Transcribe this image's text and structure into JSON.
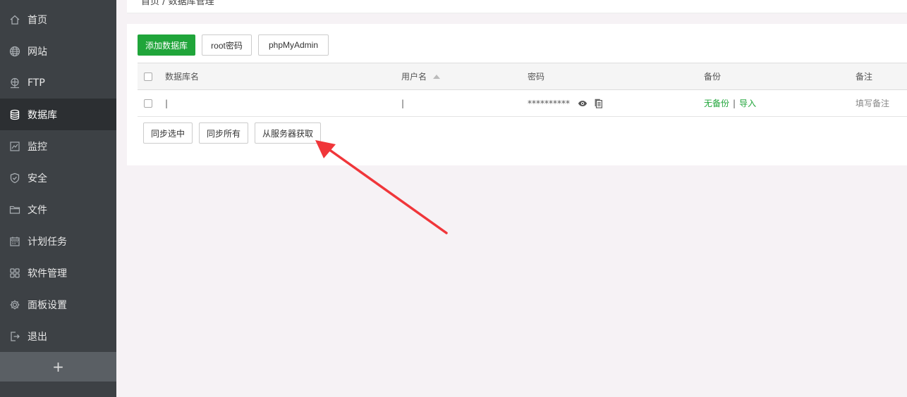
{
  "sidebar": {
    "items": [
      {
        "label": "首页",
        "icon": "home-icon"
      },
      {
        "label": "网站",
        "icon": "globe-icon"
      },
      {
        "label": "FTP",
        "icon": "ftp-icon"
      },
      {
        "label": "数据库",
        "icon": "database-icon"
      },
      {
        "label": "监控",
        "icon": "monitor-icon"
      },
      {
        "label": "安全",
        "icon": "shield-icon"
      },
      {
        "label": "文件",
        "icon": "folder-icon"
      },
      {
        "label": "计划任务",
        "icon": "calendar-icon"
      },
      {
        "label": "软件管理",
        "icon": "apps-icon"
      },
      {
        "label": "面板设置",
        "icon": "gear-icon"
      },
      {
        "label": "退出",
        "icon": "logout-icon"
      }
    ],
    "active_index": 3,
    "add_label": "+"
  },
  "breadcrumb": {
    "text": "首页 / 数据库管理"
  },
  "toolbar": {
    "add_db_label": "添加数据库",
    "root_pwd_label": "root密码",
    "phpmyadmin_label": "phpMyAdmin"
  },
  "table": {
    "headers": {
      "db_name": "数据库名",
      "username": "用户名",
      "password": "密码",
      "backup": "备份",
      "note": "备注"
    },
    "rows": [
      {
        "db_name": "|",
        "username": "|",
        "password": "**********",
        "backup_none": "无备份",
        "backup_sep": "|",
        "import": "导入",
        "note": "填写备注"
      }
    ]
  },
  "actions": {
    "sync_selected": "同步选中",
    "sync_all": "同步所有",
    "fetch_server": "从服务器获取"
  },
  "colors": {
    "accent": "#20a53a",
    "sidebar_bg": "#3d4145",
    "annotation_arrow": "#f0363a"
  }
}
